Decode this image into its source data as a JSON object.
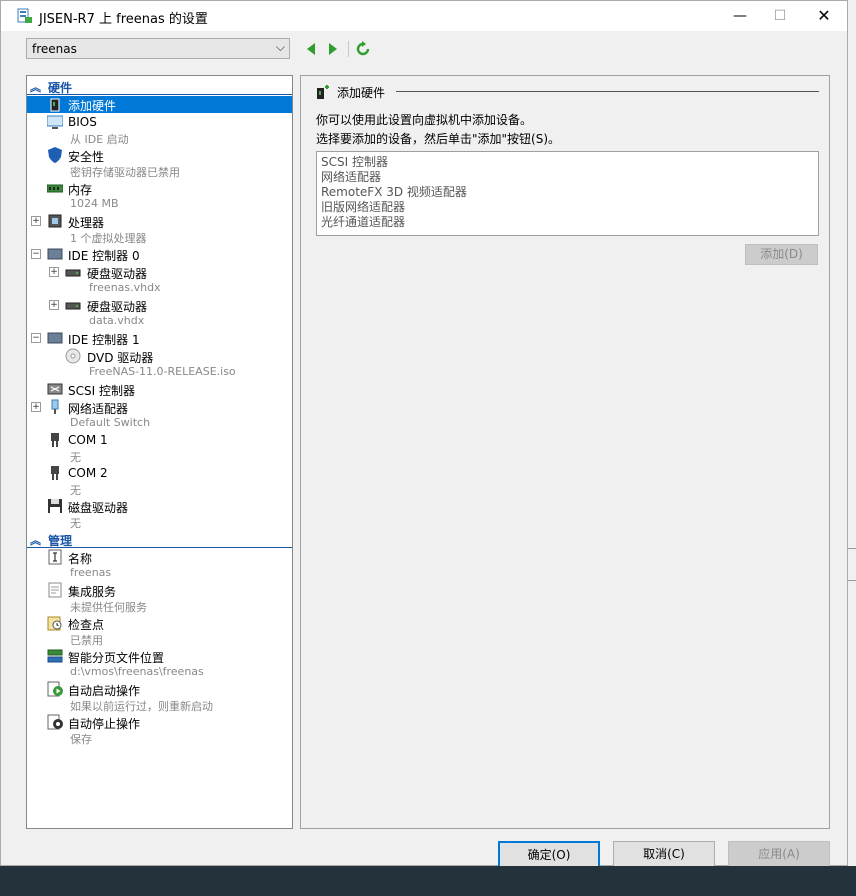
{
  "window": {
    "title": "JISEN-R7 上 freenas 的设置"
  },
  "vm_select": {
    "value": "freenas"
  },
  "tree": {
    "hardware_section": "硬件",
    "management_section": "管理",
    "items": {
      "add_hardware": {
        "label": "添加硬件"
      },
      "bios": {
        "label": "BIOS",
        "sub": "从 IDE 启动"
      },
      "security": {
        "label": "安全性",
        "sub": "密钥存储驱动器已禁用"
      },
      "memory": {
        "label": "内存",
        "sub": "1024 MB"
      },
      "processor": {
        "label": "处理器",
        "sub": "1 个虚拟处理器"
      },
      "ide0": {
        "label": "IDE 控制器 0"
      },
      "hdd1": {
        "label": "硬盘驱动器",
        "sub": "freenas.vhdx"
      },
      "hdd2": {
        "label": "硬盘驱动器",
        "sub": "data.vhdx"
      },
      "ide1": {
        "label": "IDE 控制器 1"
      },
      "dvd": {
        "label": "DVD 驱动器",
        "sub": "FreeNAS-11.0-RELEASE.iso"
      },
      "scsi": {
        "label": "SCSI 控制器"
      },
      "net": {
        "label": "网络适配器",
        "sub": "Default Switch"
      },
      "com1": {
        "label": "COM 1",
        "sub": "无"
      },
      "com2": {
        "label": "COM 2",
        "sub": "无"
      },
      "floppy": {
        "label": "磁盘驱动器",
        "sub": "无"
      },
      "name": {
        "label": "名称",
        "sub": "freenas"
      },
      "integration": {
        "label": "集成服务",
        "sub": "未提供任何服务"
      },
      "checkpoint": {
        "label": "检查点",
        "sub": "已禁用"
      },
      "paging": {
        "label": "智能分页文件位置",
        "sub": "d:\\vmos\\freenas\\freenas"
      },
      "autostart": {
        "label": "自动启动操作",
        "sub": "如果以前运行过，则重新启动"
      },
      "autostop": {
        "label": "自动停止操作",
        "sub": "保存"
      }
    }
  },
  "panel": {
    "title": "添加硬件",
    "desc1": "你可以使用此设置向虚拟机中添加设备。",
    "desc2": "选择要添加的设备，然后单击\"添加\"按钮(S)。",
    "devices": [
      "SCSI 控制器",
      "网络适配器",
      "RemoteFX 3D 视频适配器",
      "旧版网络适配器",
      "光纤通道适配器"
    ],
    "add_button": "添加(D)"
  },
  "buttons": {
    "ok": "确定(O)",
    "cancel": "取消(C)",
    "apply": "应用(A)"
  },
  "colors": {
    "accent": "#0078d7",
    "section": "#1a56a8"
  }
}
